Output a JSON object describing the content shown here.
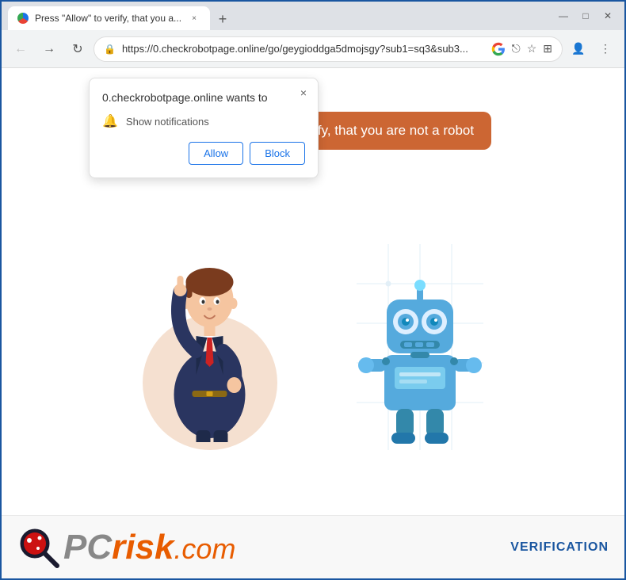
{
  "browser": {
    "tab_title": "Press \"Allow\" to verify, that you a...",
    "new_tab_label": "+",
    "url": "https://0.checkrobotpage.online/go/geygioddga5dmojsgy?sub1=sq3&sub3...",
    "window_controls": {
      "minimize": "—",
      "maximize": "□",
      "close": "✕"
    }
  },
  "toolbar": {
    "back_title": "Back",
    "forward_title": "Forward",
    "reload_title": "Reload",
    "lock_icon": "🔒",
    "bookmark_icon": "☆",
    "extensions_icon": "⊞",
    "profile_icon": "👤",
    "menu_icon": "⋮",
    "chrome_icon": "⊕",
    "share_icon": "⎋"
  },
  "notification_popup": {
    "title": "0.checkrobotpage.online wants to",
    "permission_label": "Show notifications",
    "allow_button": "Allow",
    "block_button": "Block",
    "close_label": "×"
  },
  "speech_bubble": {
    "text": "Press \"Allow\" to verify, that you are not a robot"
  },
  "branding": {
    "logo_pc": "PC",
    "logo_risk": "risk",
    "logo_com": ".com",
    "verification_label": "VERIFICATION"
  }
}
